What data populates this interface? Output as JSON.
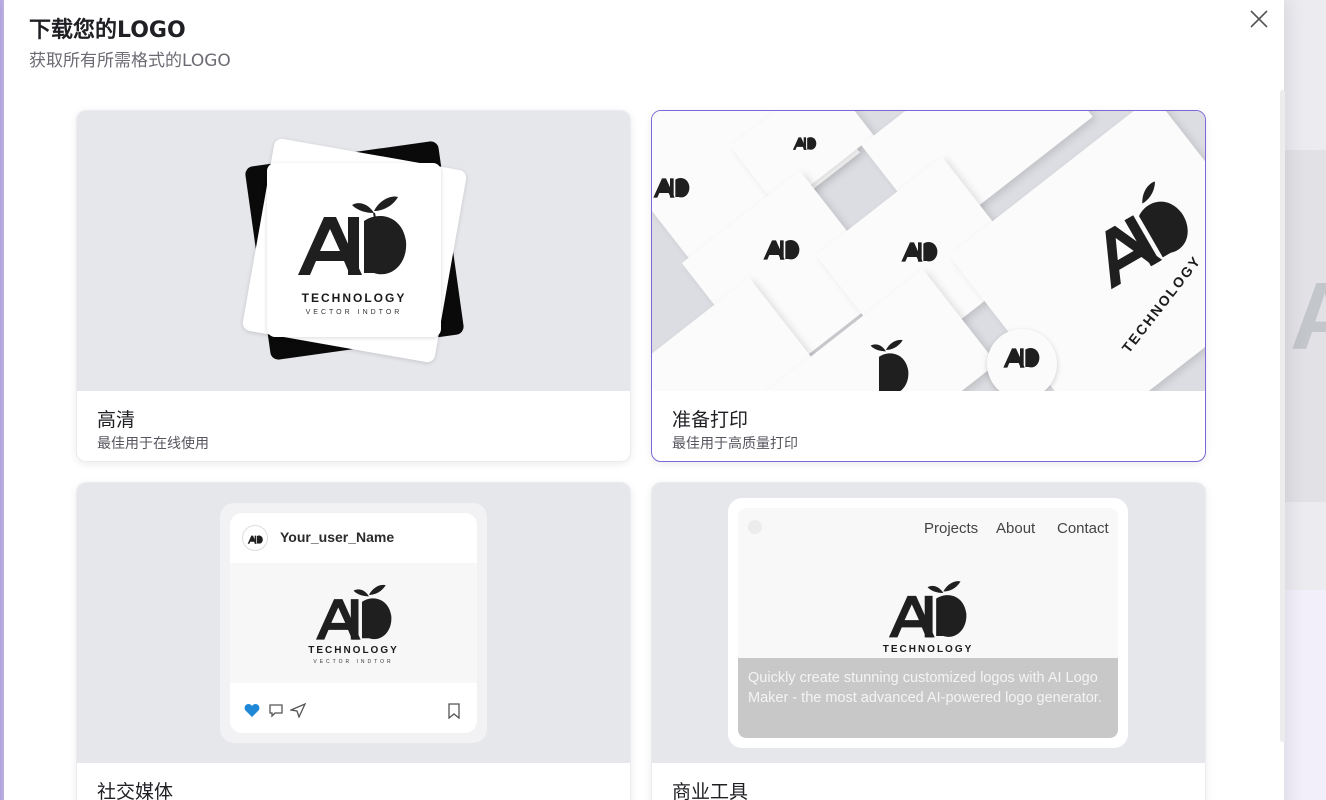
{
  "modal": {
    "title": "下载您的LOGO",
    "subtitle": "获取所有所需格式的LOGO"
  },
  "logo": {
    "letters": "AI",
    "name": "TECHNOLOGY",
    "tagline": "VECTOR INDTOR"
  },
  "options": [
    {
      "name": "高清",
      "desc": "最佳用于在线使用",
      "selected": false
    },
    {
      "name": "准备打印",
      "desc": "最佳用于高质量打印",
      "selected": true
    },
    {
      "name": "社交媒体",
      "desc": "",
      "selected": false
    },
    {
      "name": "商业工具",
      "desc": "",
      "selected": false
    }
  ],
  "social": {
    "username": "Your_user_Name"
  },
  "business": {
    "nav": [
      "Projects",
      "About",
      "Contact"
    ],
    "overlay_text": "Quickly create stunning customized logos with AI Logo Maker - the most advanced AI-powered logo generator."
  },
  "colors": {
    "accent": "#7e66d8",
    "like": "#1e88d6"
  }
}
